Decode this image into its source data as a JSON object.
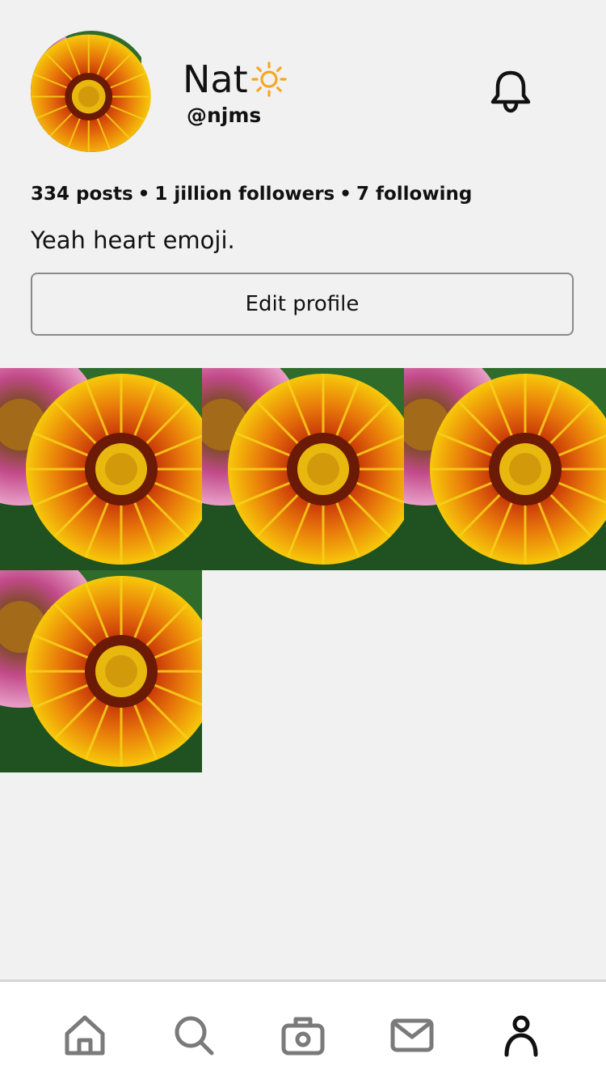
{
  "profile": {
    "display_name": "Nat",
    "handle": "@njms",
    "posts": "334 posts",
    "followers": "1 jillion followers",
    "following": "7 following",
    "separator": "•",
    "bio": "Yeah heart emoji.",
    "edit_label": "Edit profile"
  },
  "posts_grid": [
    {
      "image": "orange-gazania-flower-photo"
    },
    {
      "image": "orange-gazania-flower-photo"
    },
    {
      "image": "orange-gazania-flower-photo"
    },
    {
      "image": "orange-gazania-flower-photo"
    }
  ],
  "tabbar": {
    "items": [
      {
        "icon": "home-icon",
        "active": false
      },
      {
        "icon": "search-icon",
        "active": false
      },
      {
        "icon": "camera-icon",
        "active": false
      },
      {
        "icon": "mail-icon",
        "active": false
      },
      {
        "icon": "profile-icon",
        "active": true
      }
    ]
  },
  "colors": {
    "background": "#f1f1f1",
    "text": "#111111",
    "inactive_icon": "#7a7a7a",
    "active_icon": "#111111",
    "sun": "#f5a623"
  }
}
